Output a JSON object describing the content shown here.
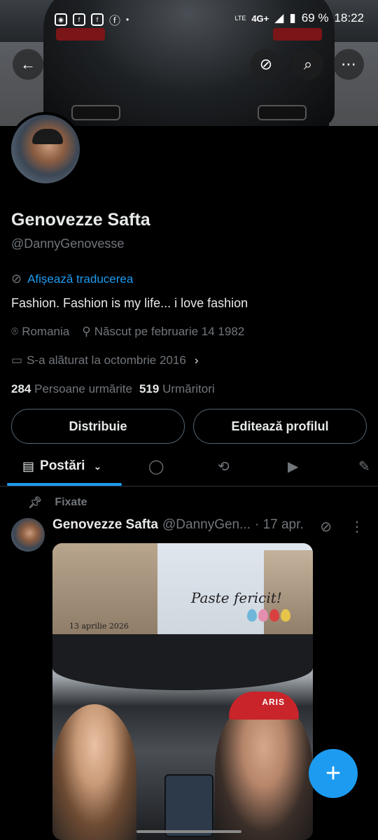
{
  "status_bar": {
    "network": "4G+",
    "lte": "LTE",
    "battery": "69 %",
    "time": "18:22"
  },
  "profile": {
    "name": "Genovezze Safta",
    "handle": "@DannyGenovesse",
    "translate_label": "Afișează traducerea",
    "bio": "Fashion.  Fashion is my life...  i love fashion",
    "location": "Romania",
    "birth": "Născut pe februarie 14 1982",
    "joined": "S-a alăturat la octombrie 2016",
    "following_count": "284",
    "following_label": "Persoane urmărite",
    "followers_count": "519",
    "followers_label": "Urmăritori"
  },
  "buttons": {
    "share": "Distribuie",
    "edit_profile": "Editează profilul"
  },
  "tabs": {
    "posts": "Postări"
  },
  "post": {
    "pinned_label": "Fixate",
    "author_name": "Genovezze Safta",
    "author_handle": "@DannyGen...",
    "date": "· 17 apr.",
    "image_text_greeting": "Paste fericit!",
    "image_text_date": "13 aprilie 2026",
    "image_text_cap": "ARIS"
  },
  "colors": {
    "accent": "#1d9bf0",
    "background": "#000000",
    "muted": "#71767b",
    "text": "#e7e9ea"
  }
}
